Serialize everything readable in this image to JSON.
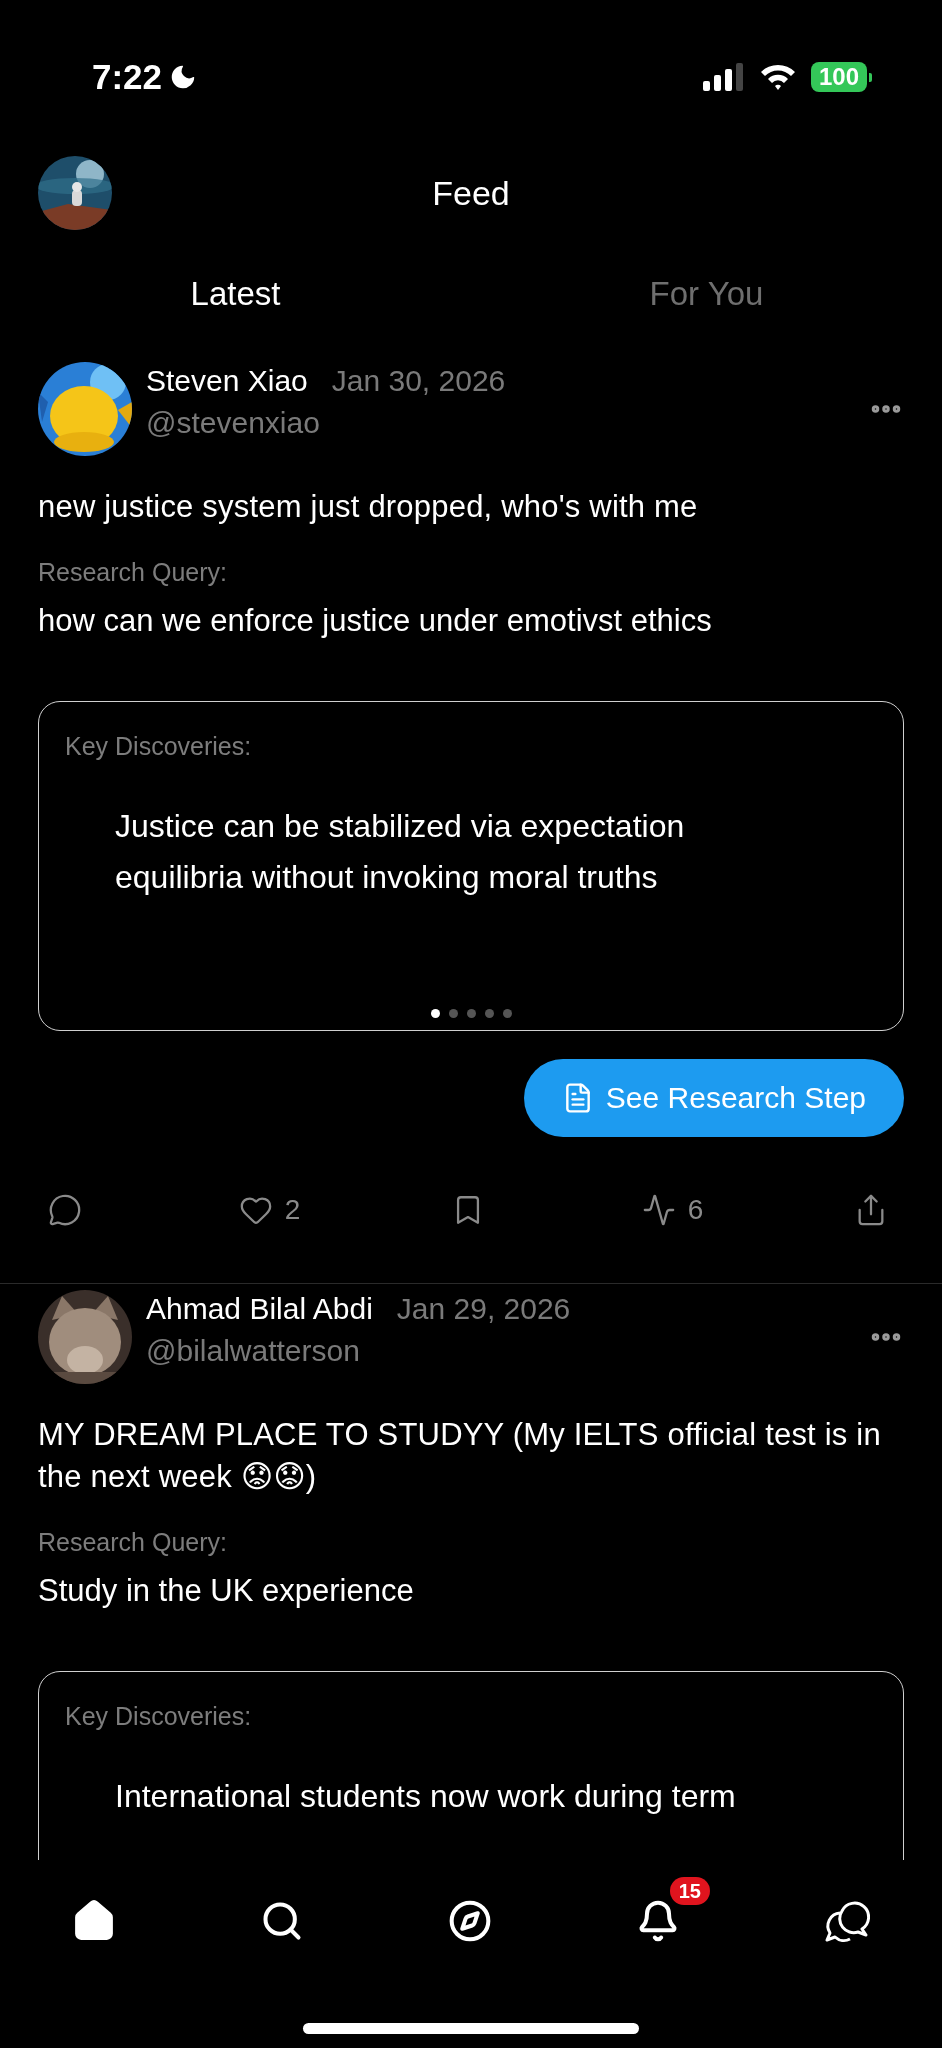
{
  "status_bar": {
    "time": "7:22",
    "battery": "100"
  },
  "header": {
    "title": "Feed"
  },
  "tabs": [
    {
      "label": "Latest",
      "selected": true
    },
    {
      "label": "For You",
      "selected": false
    }
  ],
  "posts": [
    {
      "author": "Steven Xiao",
      "date": "Jan 30, 2026",
      "handle": "@stevenxiao",
      "text": "new justice system just dropped, who's with me",
      "query_label": "Research Query:",
      "query": "how can we enforce justice under emotivst ethics",
      "discoveries_label": "Key Discoveries:",
      "discovery": "Justice can be stabilized via expectation equilibria without invoking moral truths",
      "pages": [
        {
          "selected": true
        },
        {
          "selected": false
        },
        {
          "selected": false
        },
        {
          "selected": false
        },
        {
          "selected": false
        }
      ],
      "button": "See Research Step",
      "actions": [
        {
          "kind": "reply"
        },
        {
          "kind": "like",
          "count": "2"
        },
        {
          "kind": "bookmark"
        },
        {
          "kind": "activity",
          "count": "6"
        },
        {
          "kind": "share"
        }
      ]
    },
    {
      "author": "Ahmad Bilal Abdi",
      "date": "Jan 29, 2026",
      "handle": "@bilalwatterson",
      "text": "MY DREAM PLACE TO STUDYY (My IELTS official test is in the next week 😟😟)",
      "query_label": "Research Query:",
      "query": "Study in the UK experience",
      "discoveries_label": "Key Discoveries:",
      "discovery": "International students now work during term"
    }
  ],
  "nav": {
    "items": [
      {
        "kind": "home",
        "selected": true
      },
      {
        "kind": "search",
        "selected": false
      },
      {
        "kind": "explore",
        "selected": false
      },
      {
        "kind": "notifications",
        "selected": false,
        "badge": "15"
      },
      {
        "kind": "messages",
        "selected": false
      }
    ]
  }
}
